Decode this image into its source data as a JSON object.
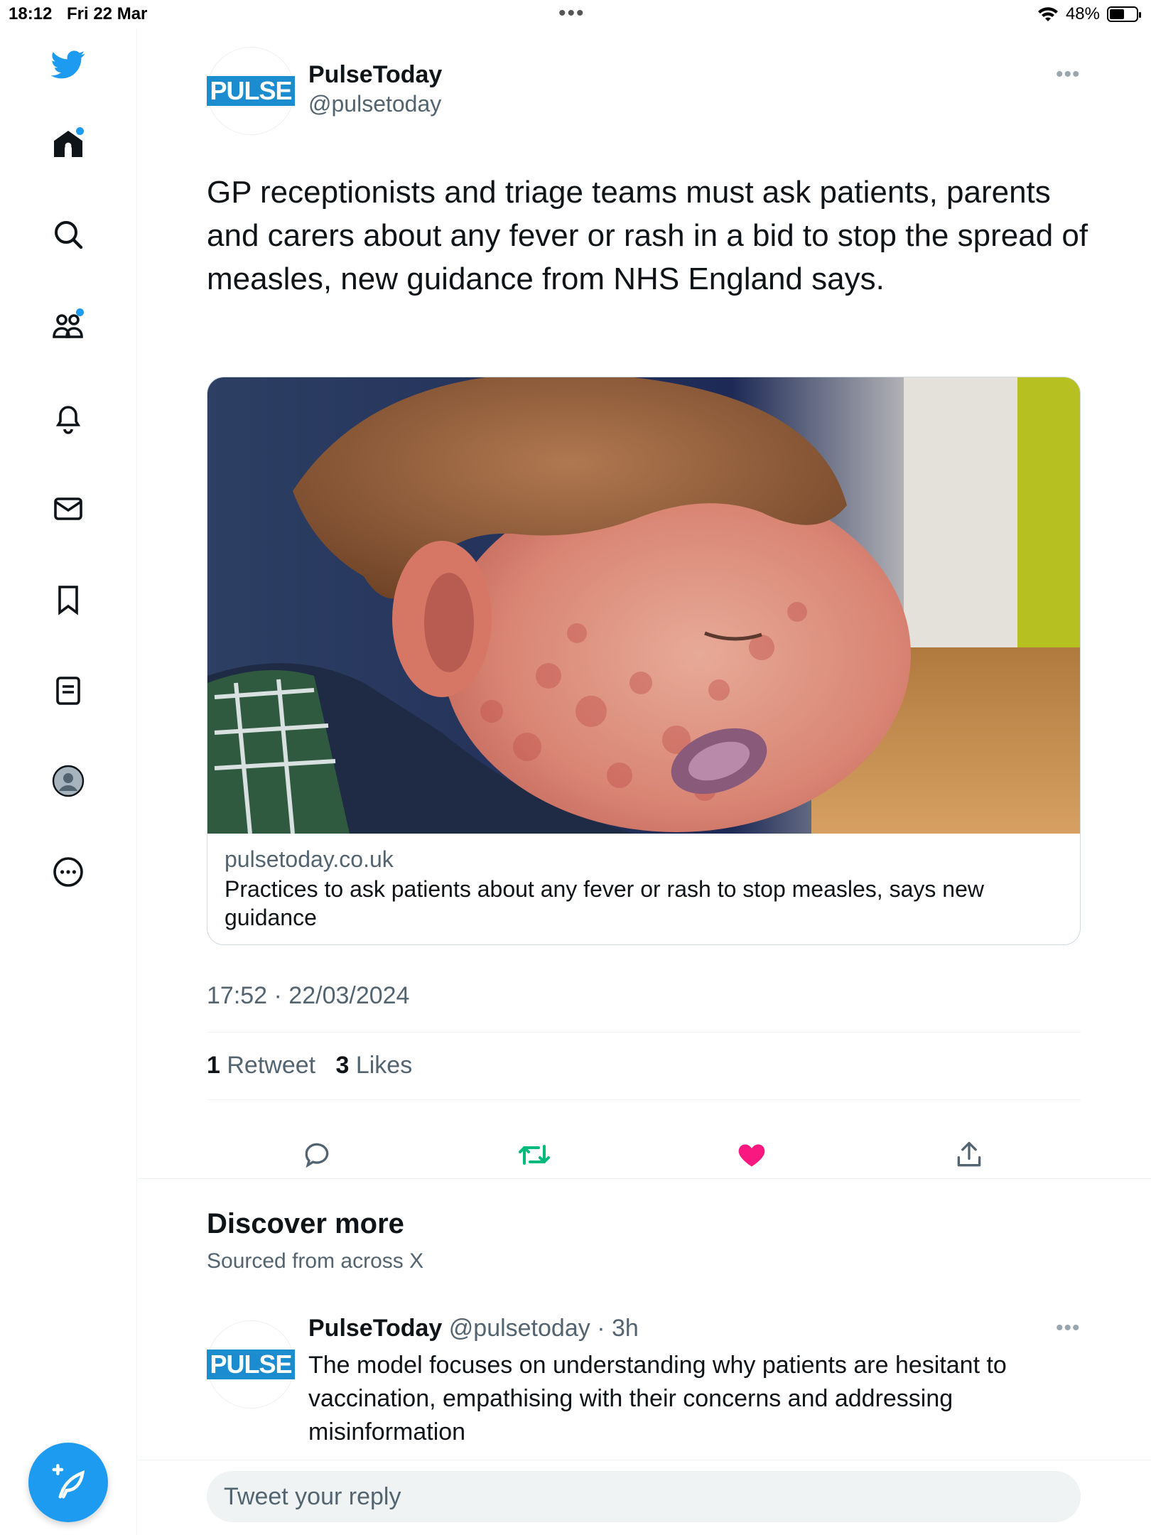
{
  "status_bar": {
    "time": "18:12",
    "date": "Fri 22 Mar",
    "battery": "48%"
  },
  "sidebar": {
    "items": [
      {
        "icon": "twitter-bird-icon"
      },
      {
        "icon": "home-icon",
        "badge": true
      },
      {
        "icon": "search-icon"
      },
      {
        "icon": "communities-icon",
        "badge": true
      },
      {
        "icon": "bell-icon"
      },
      {
        "icon": "mail-icon"
      },
      {
        "icon": "bookmark-icon"
      },
      {
        "icon": "lists-icon"
      },
      {
        "icon": "profile-icon"
      },
      {
        "icon": "more-circle-icon"
      }
    ],
    "compose_icon": "compose-feather-icon"
  },
  "tweet": {
    "author_name": "PulseToday",
    "author_handle": "@pulsetoday",
    "avatar_text": "PULSE",
    "text": "GP receptionists and triage teams must ask patients, parents and carers about any fever or rash in a bid to stop the spread of measles, new guidance from NHS England says.",
    "card": {
      "domain": "pulsetoday.co.uk",
      "title": "Practices to ask patients about any fever or rash to stop measles, says new guidance"
    },
    "timestamp": "17:52 · 22/03/2024",
    "retweets_count": "1",
    "retweets_label": "Retweet",
    "likes_count": "3",
    "likes_label": "Likes"
  },
  "discover": {
    "title": "Discover more",
    "subtitle": "Sourced from across X",
    "recommended": {
      "author_name": "PulseToday",
      "author_handle": "@pulsetoday",
      "time": "· 3h",
      "text": "The model focuses on understanding why patients are hesitant to vaccination, empathising with their concerns and addressing misinformation"
    }
  },
  "reply": {
    "placeholder": "Tweet your reply"
  },
  "colors": {
    "accent": "#1d9bf0",
    "retweet_green": "#00ba7c",
    "like_pink": "#f91880",
    "pulse_blue": "#1a8ccf"
  }
}
